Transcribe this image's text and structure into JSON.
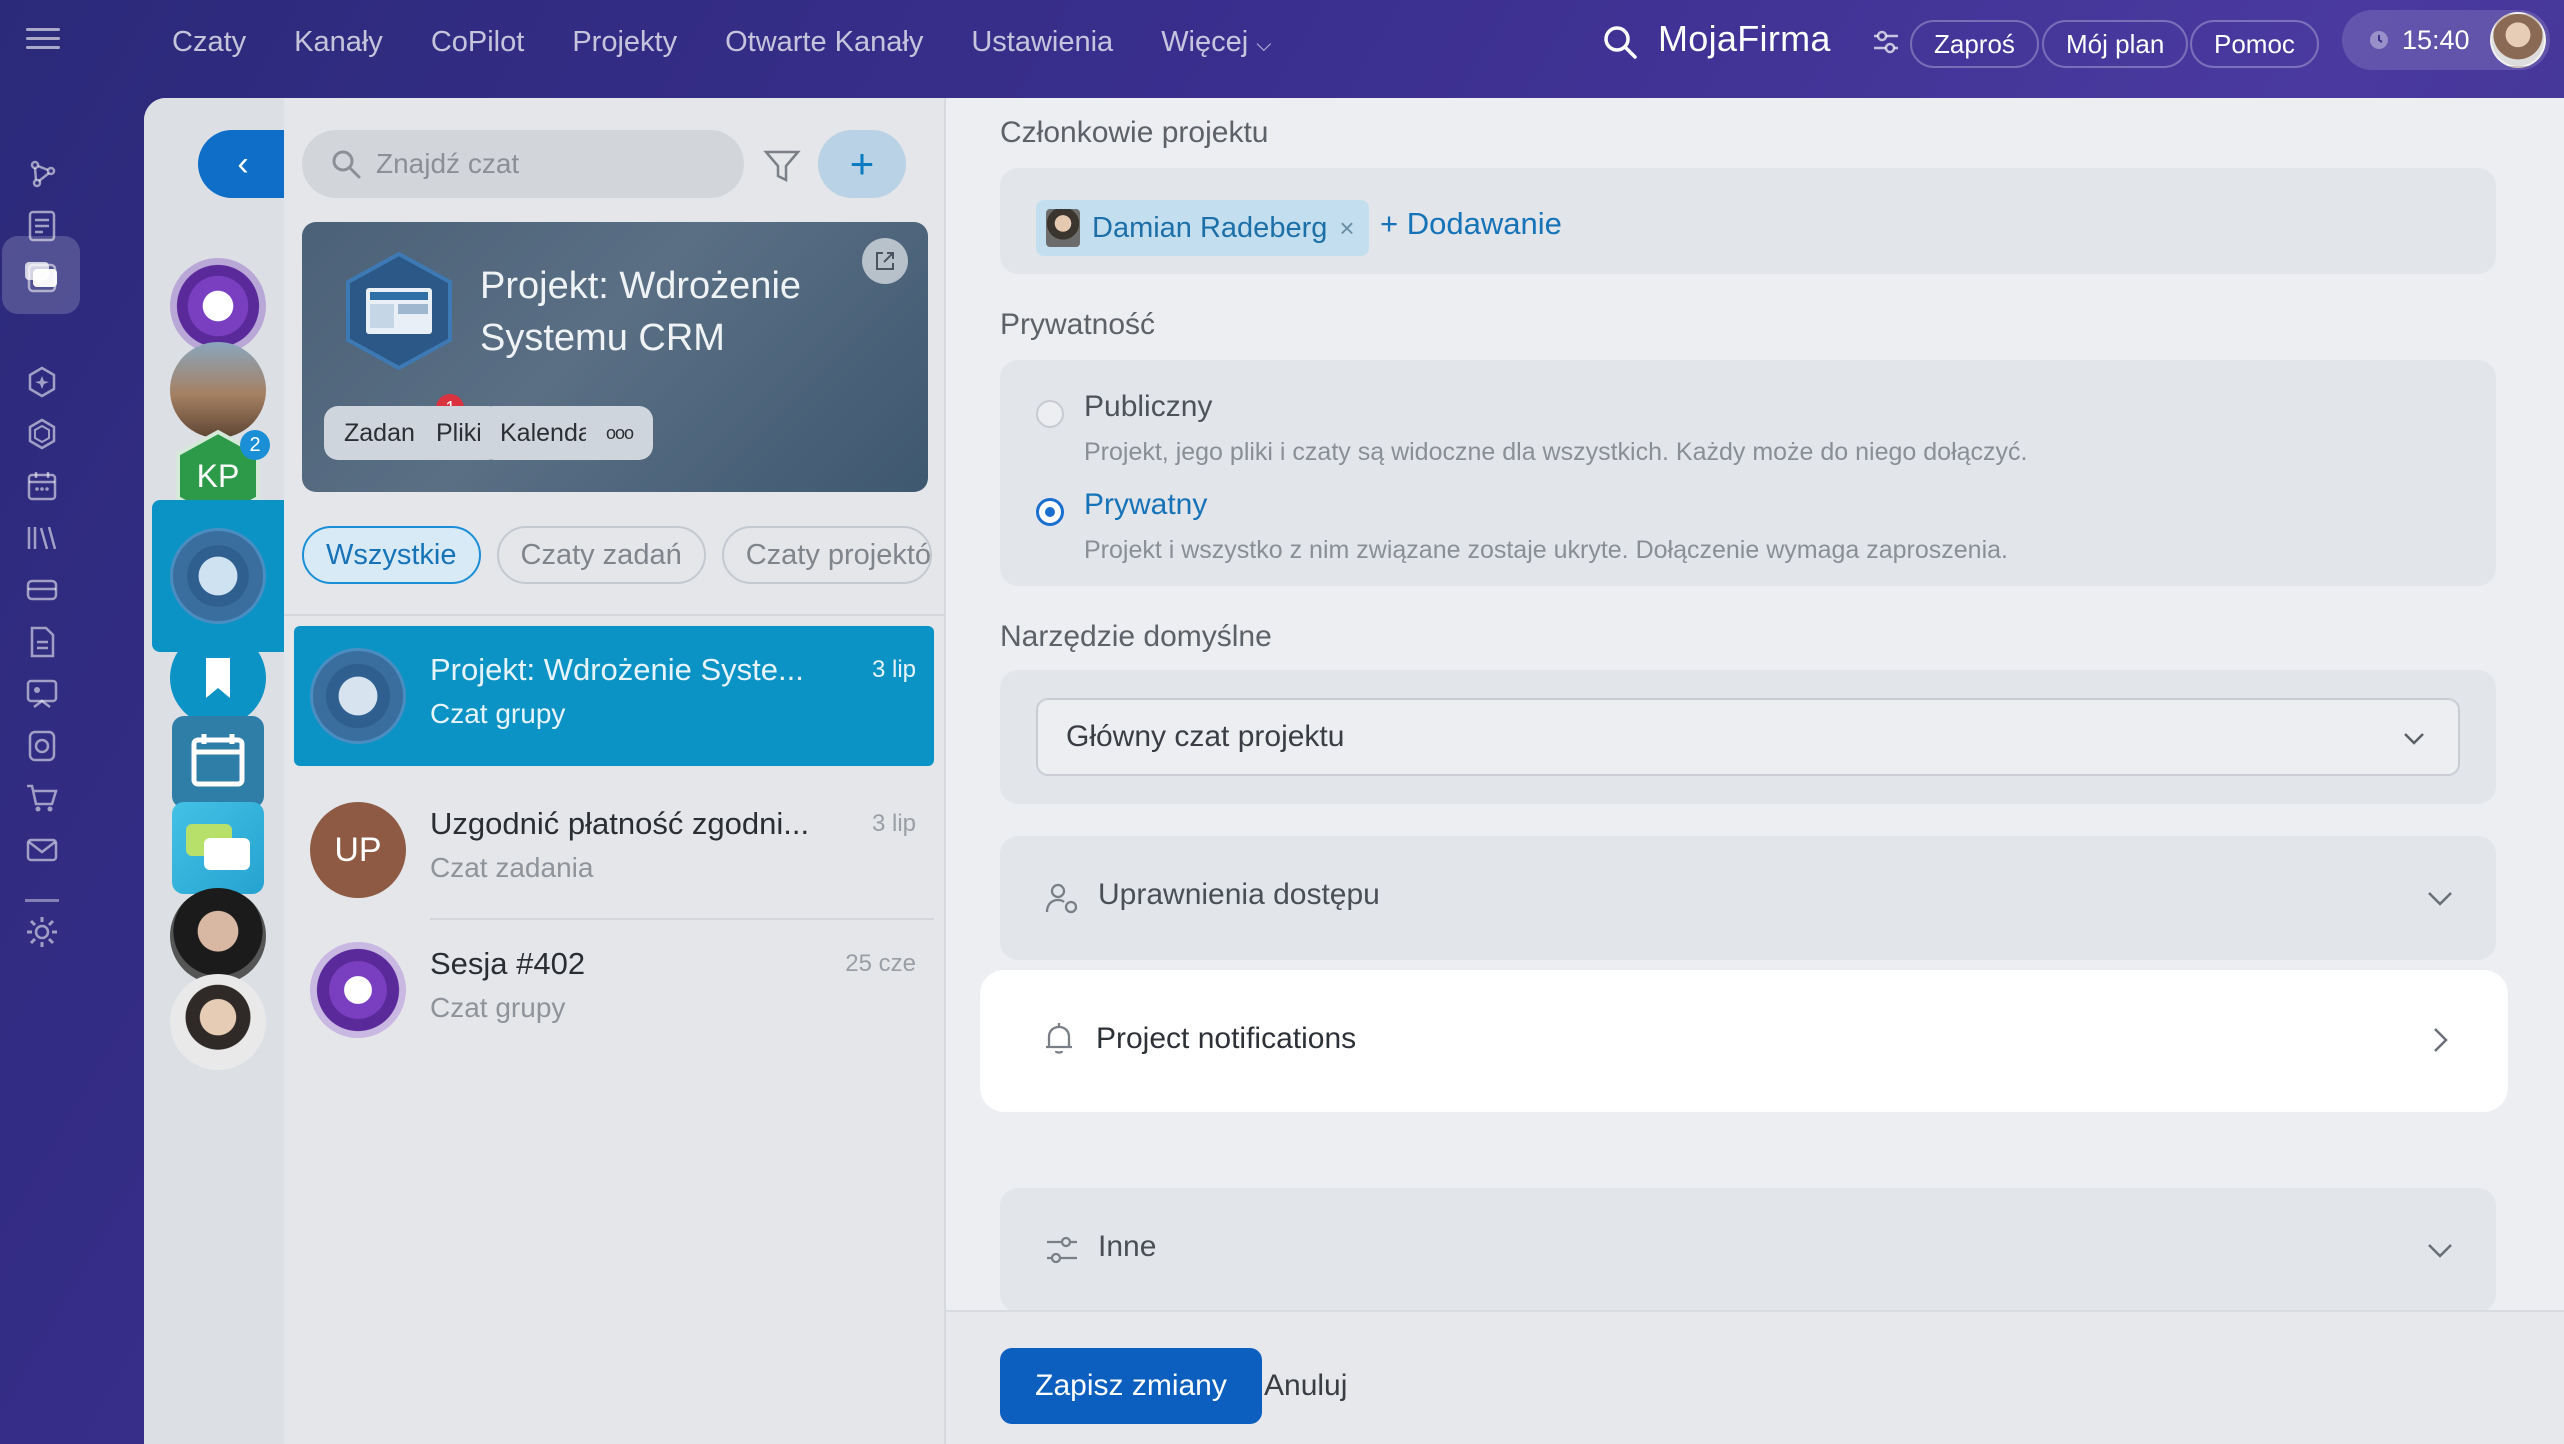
{
  "topnav": {
    "items": [
      "Czaty",
      "Kanały",
      "CoPilot",
      "Projekty",
      "Otwarte Kanały",
      "Ustawienia",
      "Więcej"
    ],
    "brand": "MojaFirma",
    "invite": "Zaproś",
    "plan": "Mój plan",
    "help": "Pomoc",
    "time": "15:40"
  },
  "chatlist": {
    "search_placeholder": "Znajdź czat",
    "project_card": {
      "title": "Projekt: Wdrożenie Systemu CRM",
      "chips": [
        "Zadania",
        "Pliki",
        "Kalendarz"
      ],
      "tasks_badge": "1",
      "more": "ooo"
    },
    "filters": [
      "Wszystkie",
      "Czaty zadań",
      "Czaty projektó"
    ],
    "chats": [
      {
        "name": "Projekt: Wdrożenie Syste...",
        "sub": "Czat grupy",
        "date": "3 lip"
      },
      {
        "name": "Uzgodnić płatność zgodni...",
        "sub": "Czat zadania",
        "date": "3 lip",
        "initials": "UP"
      },
      {
        "name": "Sesja #402",
        "sub": "Czat grupy",
        "date": "25 cze"
      }
    ]
  },
  "recent": {
    "kp_initials": "KP",
    "kp_badge": "2"
  },
  "settings": {
    "members_title": "Członkowie projektu",
    "member_name": "Damian Radeberg",
    "member_remove": "×",
    "add_member": "+ Dodawanie",
    "privacy_title": "Prywatność",
    "public_label": "Publiczny",
    "public_desc": "Projekt, jego pliki i czaty są widoczne dla wszystkich. Każdy może do niego dołączyć.",
    "private_label": "Prywatny",
    "private_desc": "Projekt i wszystko z nim związane zostaje ukryte. Dołączenie wymaga zaproszenia.",
    "default_tool_title": "Narzędzie domyślne",
    "default_tool_value": "Główny czat projektu",
    "access_rights": "Uprawnienia dostępu",
    "notifications": "Project notifications",
    "other": "Inne",
    "save": "Zapisz zmiany",
    "cancel": "Anuluj"
  },
  "colors": {
    "accent": "#0c93c6",
    "primary_button": "#0d5fbf",
    "link": "#1673b8"
  }
}
